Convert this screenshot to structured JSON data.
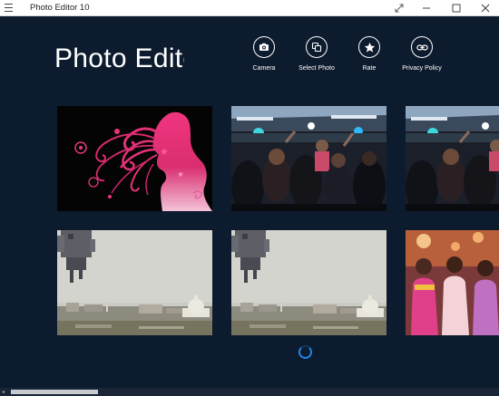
{
  "window": {
    "title": "Photo Editor 10"
  },
  "header": {
    "page_title": "Photo Editor"
  },
  "actions": [
    {
      "label": "Camera",
      "icon": "camera-icon"
    },
    {
      "label": "Select Photo",
      "icon": "select-photo-icon"
    },
    {
      "label": "Rate",
      "icon": "star-icon"
    },
    {
      "label": "Privacy Policy",
      "icon": "link-icon"
    }
  ],
  "thumbnails": [
    {
      "subject": "pink silhouette of woman with swirling hair on black"
    },
    {
      "subject": "crowd at nightclub party"
    },
    {
      "subject": "crowd at nightclub party"
    },
    {
      "subject": "spaceship over US Capitol city skyline"
    },
    {
      "subject": "spaceship over US Capitol city skyline"
    },
    {
      "subject": "group of women in colorful dresses"
    }
  ],
  "colors": {
    "background": "#0d1b2e",
    "accent": "#1e86e8",
    "titlebar": "#ffffff"
  }
}
